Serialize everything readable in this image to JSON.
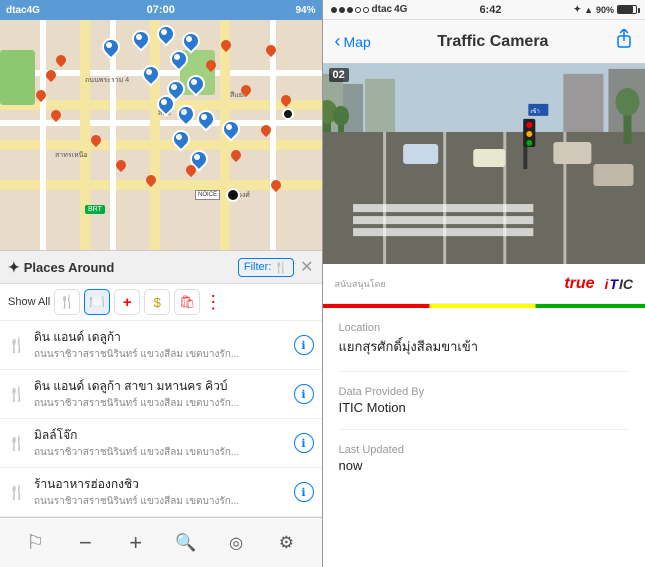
{
  "left": {
    "status": {
      "carrier": "dtac",
      "network": "4G",
      "time": "07:00",
      "battery": "94%"
    },
    "places": {
      "title": "Places Around",
      "filter_label": "Filter:",
      "filter_icon": "🍴",
      "show_all": "Show All",
      "categories": [
        {
          "icon": "🍴",
          "label": "food"
        },
        {
          "icon": "🛒",
          "label": "shop"
        },
        {
          "icon": "➕",
          "label": "medical"
        },
        {
          "icon": "💲",
          "label": "atm"
        },
        {
          "icon": "🛍️",
          "label": "store"
        }
      ],
      "items": [
        {
          "name": "ดิน แอนด์ เดลูก้า",
          "address": "ถนนราชิวาสราชนิรินทร์ แขวงสีลม เขตบางรัก..."
        },
        {
          "name": "ดิน แอนด์ เดลูก้า สาขา มหานคร คิวบ์",
          "address": "ถนนราชิวาสราชนิรินทร์ แขวงสีลม เขตบางรัก..."
        },
        {
          "name": "มิลล์โจ๊ก",
          "address": "ถนนราชิวาสราชนิรินทร์ แขวงสีลม เขตบางรัก..."
        },
        {
          "name": "ร้านอาหารฮ่องกงชิว",
          "address": "ถนนราชิวาสราชนิรินทร์ แขวงสีลม เขตบางรัก..."
        }
      ]
    },
    "toolbar": [
      {
        "icon": "⚑",
        "name": "explore"
      },
      {
        "icon": "−",
        "name": "zoom-out"
      },
      {
        "icon": "+",
        "name": "zoom-in"
      },
      {
        "icon": "🔍",
        "name": "search"
      },
      {
        "icon": "◎",
        "name": "locate"
      },
      {
        "icon": "⚙",
        "name": "settings"
      }
    ]
  },
  "right": {
    "status": {
      "dots": 5,
      "carrier": "dtac",
      "network": "4G",
      "time": "6:42",
      "bluetooth": true,
      "battery": "90%"
    },
    "nav": {
      "back_label": "Map",
      "title": "Traffic Camera",
      "share": "share"
    },
    "camera": {
      "number": "02",
      "sponsor_text": "สนับสนุนโดย",
      "sponsor_true": "true",
      "sponsor_itic": "iTIC"
    },
    "info": {
      "location_label": "Location",
      "location_value": "แยกสุรศักดิ์มุ่งสีลมขาเข้า",
      "provider_label": "Data Provided By",
      "provider_value": "ITIC Motion",
      "updated_label": "Last Updated",
      "updated_value": "now"
    }
  }
}
